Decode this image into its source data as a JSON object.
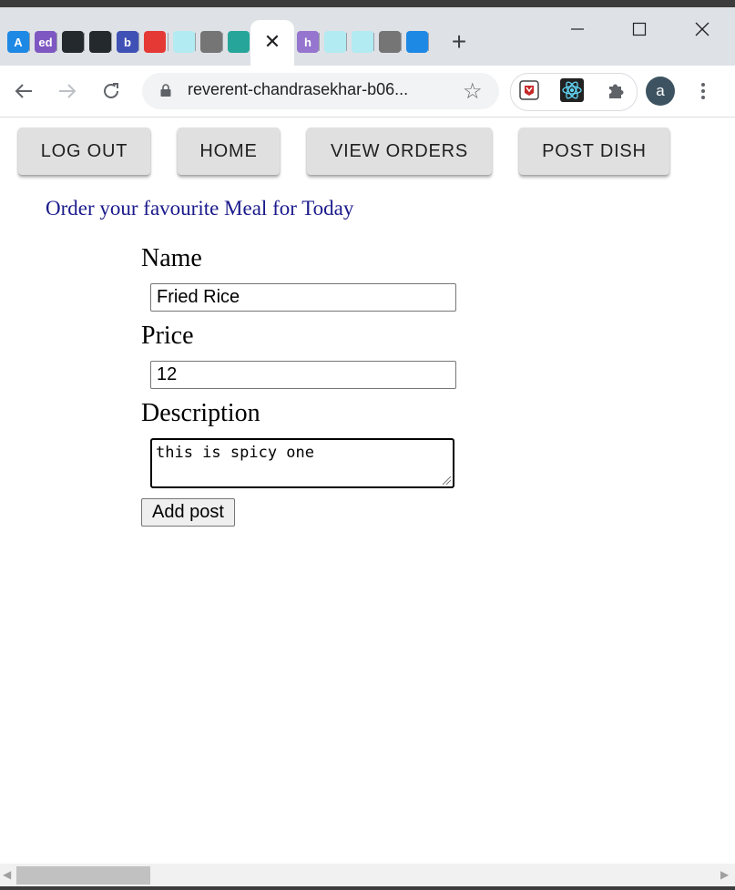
{
  "browser": {
    "tab_close_glyph": "✕",
    "new_tab_glyph": "+",
    "tab_favicons": [
      {
        "name": "atlas-tab-icon",
        "letter": "A",
        "color": "#1e88e5"
      },
      {
        "name": "edpuzzle-tab-icon",
        "letter": "ed",
        "color": "#7e57c2"
      },
      {
        "name": "github-tab-icon",
        "letter": "",
        "color": "#24292e"
      },
      {
        "name": "github-tab-icon-2",
        "letter": "",
        "color": "#24292e"
      },
      {
        "name": "b-tab-icon",
        "letter": "b",
        "color": "#3f51b5"
      },
      {
        "name": "trello-like-tab-icon",
        "letter": "",
        "color": "#e53935"
      },
      {
        "name": "pattern-tab-icon",
        "letter": "",
        "color": "#b2ebf2"
      },
      {
        "name": "globe-tab-icon",
        "letter": "",
        "color": "#757575"
      },
      {
        "name": "check-tab-icon",
        "letter": "",
        "color": "#26a69a"
      },
      {
        "name": "heroku-tab-icon",
        "letter": "h",
        "color": "#9575cd"
      },
      {
        "name": "pattern-tab-icon-2",
        "letter": "",
        "color": "#b2ebf2"
      },
      {
        "name": "pattern-tab-icon-3",
        "letter": "",
        "color": "#b2ebf2"
      },
      {
        "name": "globe-tab-icon-2",
        "letter": "",
        "color": "#757575"
      },
      {
        "name": "table-tab-icon",
        "letter": "",
        "color": "#1e88e5"
      }
    ],
    "url": "reverent-chandrasekhar-b06...",
    "profile_initial": "a"
  },
  "nav": {
    "logout_label": "LOG OUT",
    "home_label": "HOME",
    "orders_label": "VIEW ORDERS",
    "post_label": "POST DISH"
  },
  "page": {
    "tagline": "Order your favourite Meal for Today"
  },
  "form": {
    "name_label": "Name",
    "name_value": "Fried Rice",
    "price_label": "Price",
    "price_value": "12",
    "description_label": "Description",
    "description_value": "this is spicy one",
    "submit_label": "Add post"
  },
  "colors": {
    "tagline": "#1a1a8c",
    "nav_button_bg": "#e0e0e0"
  }
}
